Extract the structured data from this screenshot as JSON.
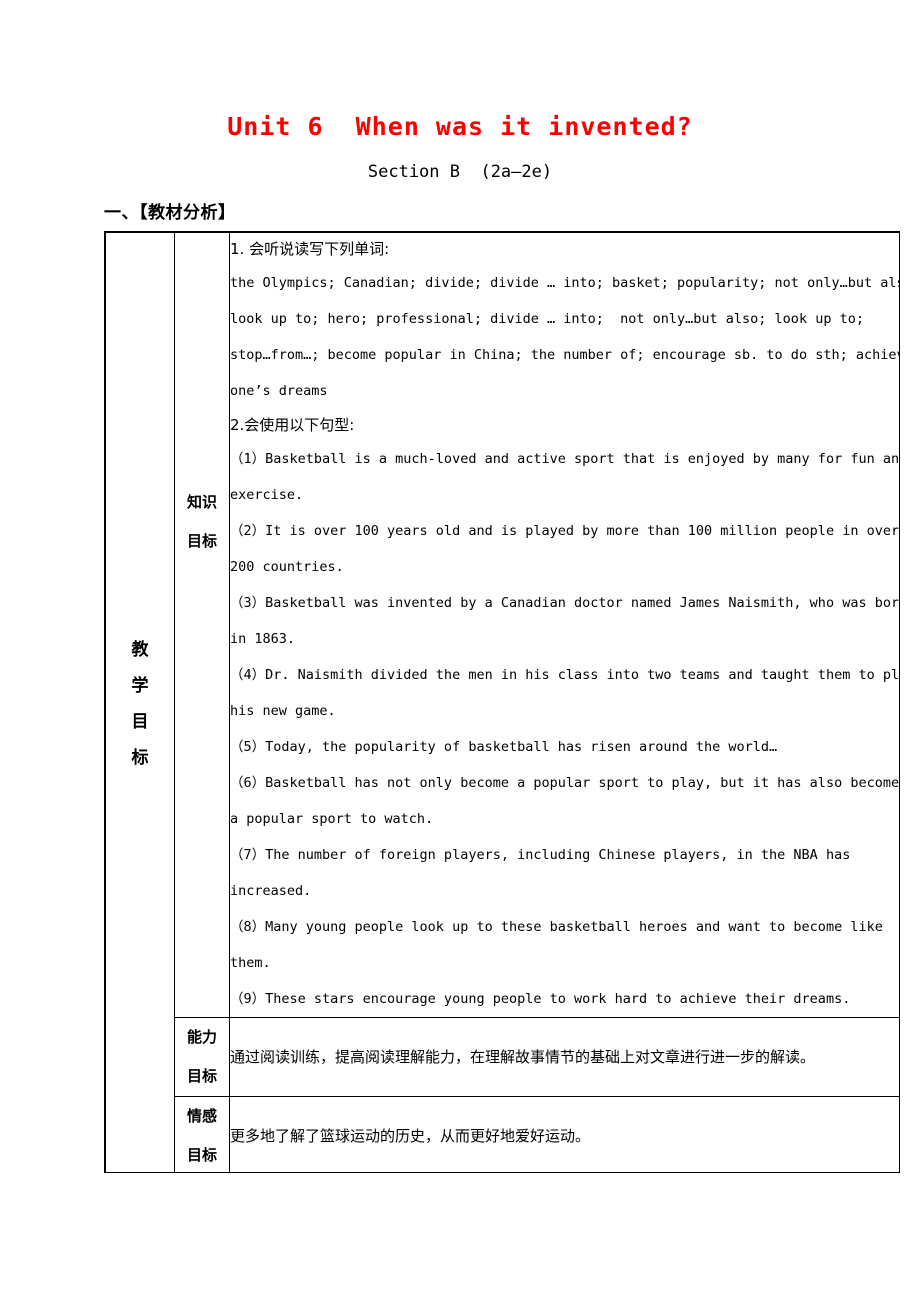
{
  "title": {
    "main": "Unit 6  When was it invented?",
    "sub": "Section B  (2a—2e)",
    "color": "#FF0000"
  },
  "section_heading": "一、【教材分析】",
  "table": {
    "row_label_main": [
      "教",
      "学",
      "目",
      "标"
    ],
    "rows": [
      {
        "label": [
          "知识",
          "目标"
        ],
        "lines": [
          "1. 会听说读写下列单词:",
          "the Olympics; Canadian; divide; divide … into; basket; popularity; not only…but also;",
          "look up to; hero; professional; divide … into;  not only…but also; look up to;",
          "stop…from…; become popular in China; the number of; encourage sb. to do sth; achieve",
          "one’s dreams",
          "2.会使用以下句型:",
          "（1）Basketball is a much-loved and active sport that is enjoyed by many for fun and",
          "exercise.",
          "（2）It is over 100 years old and is played by more than 100 million people in over",
          "200 countries.",
          "（3）Basketball was invented by a Canadian doctor named James Naismith, who was born",
          "in 1863.",
          "（4）Dr. Naismith divided the men in his class into two teams and taught them to play",
          "his new game.",
          "（5）Today, the popularity of basketball has risen around the world…",
          "（6）Basketball has not only become a popular sport to play, but it has also become",
          "a popular sport to watch.",
          "（7）The number of foreign players, including Chinese players, in the NBA has",
          "increased.",
          "（8）Many young people look up to these basketball heroes and want to become like",
          "them.",
          "（9）These stars encourage young people to work hard to achieve their dreams."
        ]
      },
      {
        "label": [
          "能力",
          "目标"
        ],
        "body": "通过阅读训练，提高阅读理解能力，在理解故事情节的基础上对文章进行进一步的解读。"
      },
      {
        "label": [
          "情感",
          "目标"
        ],
        "body": "更多地了解了篮球运动的历史，从而更好地爱好运动。"
      }
    ]
  }
}
